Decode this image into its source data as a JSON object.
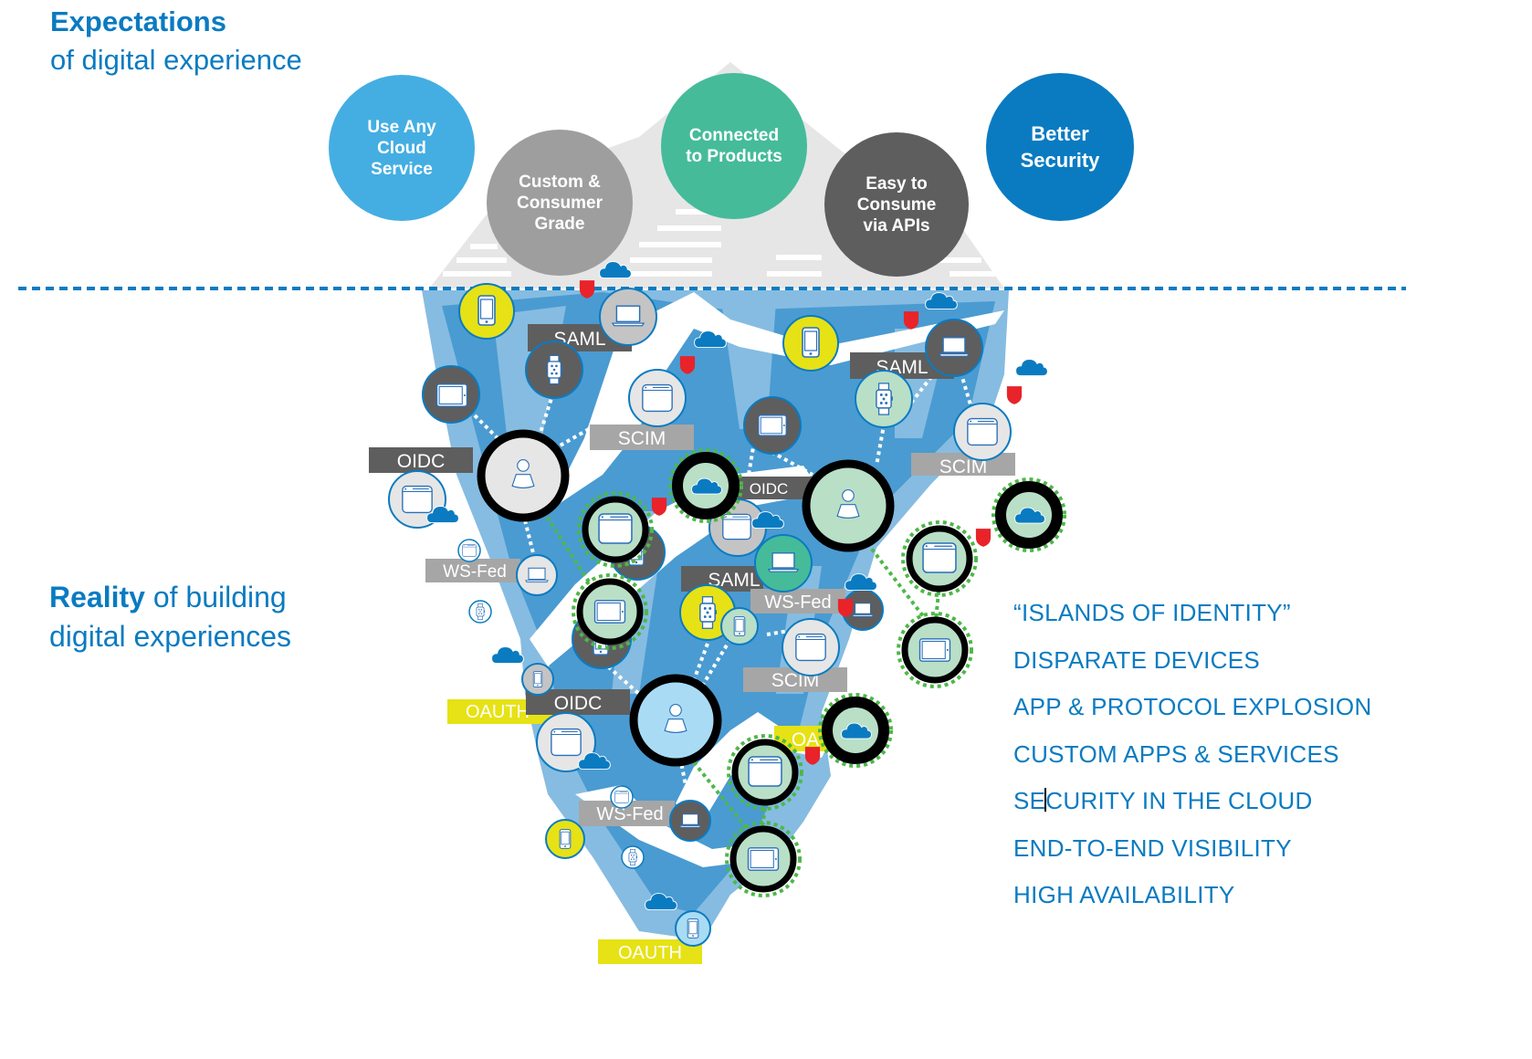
{
  "expectations": {
    "title_bold": "Expectations",
    "title_rest": "of digital experience",
    "circles": [
      {
        "label": "Use Any\nCloud\nService",
        "color": "#44aee2"
      },
      {
        "label": "Custom &\nConsumer\nGrade",
        "color": "#9e9e9e"
      },
      {
        "label": "Connected\nto Products",
        "color": "#45bb9a"
      },
      {
        "label": "Easy to\nConsume\nvia APIs",
        "color": "#5e5e5e"
      },
      {
        "label": "Better\nSecurity",
        "color": "#0a7bc1"
      }
    ]
  },
  "reality": {
    "title_bold": "Reality",
    "title_rest_line1": " of building",
    "title_rest_line2": "digital experiences"
  },
  "protocol_labels": {
    "saml_1": "SAML",
    "saml_2": "SAML",
    "saml_3": "SAML",
    "scim_1": "SCIM",
    "scim_2": "SCIM",
    "scim_3": "SCIM",
    "oidc_1": "OIDC",
    "oidc_2": "OIDC",
    "oidc_3": "OIDC",
    "wsfed_1": "WS-Fed",
    "wsfed_2": "WS-Fed",
    "wsfed_3": "WS-Fed",
    "oauth_1": "OAUTH",
    "oauth_2": "OA",
    "oauth_3": "OAUTH"
  },
  "challenges": {
    "items": [
      "“ISLANDS OF IDENTITY”",
      "DISPARATE DEVICES",
      "APP & PROTOCOL EXPLOSION",
      "CUSTOM APPS & SERVICES",
      "SECURITY IN THE CLOUD",
      "END-TO-END VISIBILITY",
      "HIGH AVAILABILITY"
    ],
    "cursor_item_index": 4,
    "cursor_after_chars": 2
  },
  "colors": {
    "brand_blue": "#0a7bc1",
    "ice_dark": "#4a9bd2",
    "ice_light": "#86bce1",
    "ice_top": "#e6e6e6",
    "label_dark": "#5e5e5e",
    "label_gray": "#a6a6a6",
    "label_yellow": "#e6e215",
    "node_yellow": "#e6e215",
    "node_mint": "#b9dfc7",
    "node_light": "#e6e6e6",
    "node_sky": "#a9dcf4",
    "node_teal": "#45bb9a",
    "shield_red": "#e8232a",
    "dotted_green": "#4db848"
  }
}
